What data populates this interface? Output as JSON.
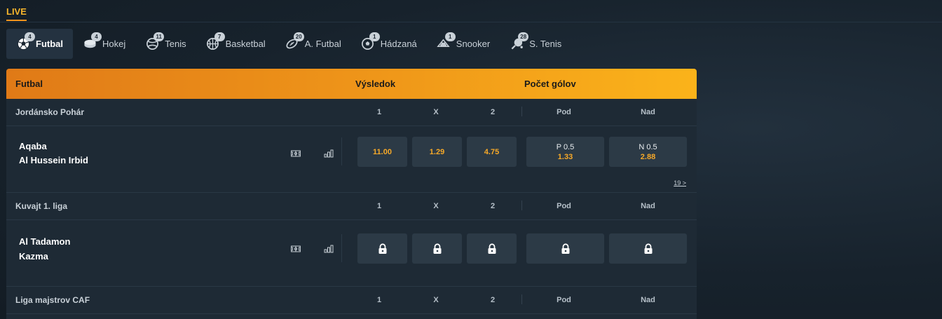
{
  "section": {
    "live_label": "LIVE"
  },
  "sports": [
    {
      "name": "Futbal",
      "count": "4",
      "icon": "soccer-ball-icon",
      "active": true
    },
    {
      "name": "Hokej",
      "count": "4",
      "icon": "hockey-puck-icon"
    },
    {
      "name": "Tenis",
      "count": "11",
      "icon": "tennis-ball-icon"
    },
    {
      "name": "Basketbal",
      "count": "7",
      "icon": "basketball-icon"
    },
    {
      "name": "A. Futbal",
      "count": "20",
      "icon": "american-football-icon"
    },
    {
      "name": "Hádzaná",
      "count": "1",
      "icon": "handball-icon"
    },
    {
      "name": "Snooker",
      "count": "1",
      "icon": "snooker-icon"
    },
    {
      "name": "S. Tenis",
      "count": "28",
      "icon": "table-tennis-icon"
    }
  ],
  "table": {
    "sport": "Futbal",
    "result_header": "Výsledok",
    "goals_header": "Počet gólov",
    "col_1": "1",
    "col_x": "X",
    "col_2": "2",
    "col_under": "Pod",
    "col_over": "Nad"
  },
  "leagues": [
    {
      "name": "Jordánsko Pohár",
      "match": {
        "home": "Aqaba",
        "away": "Al Hussein Irbid",
        "odds": {
          "o1": "11.00",
          "ox": "1.29",
          "o2": "4.75"
        },
        "under": {
          "line": "P 0.5",
          "value": "1.33"
        },
        "over": {
          "line": "N 0.5",
          "value": "2.88"
        },
        "more": "19 >",
        "locked": false
      }
    },
    {
      "name": "Kuvajt 1. liga",
      "match": {
        "home": "Al Tadamon",
        "away": "Kazma",
        "locked": true
      }
    },
    {
      "name": "Liga majstrov CAF"
    }
  ],
  "colors": {
    "accent": "#f7931e",
    "odds": "#f7a928",
    "panel": "#1e2a35",
    "button": "#2c3a46"
  }
}
